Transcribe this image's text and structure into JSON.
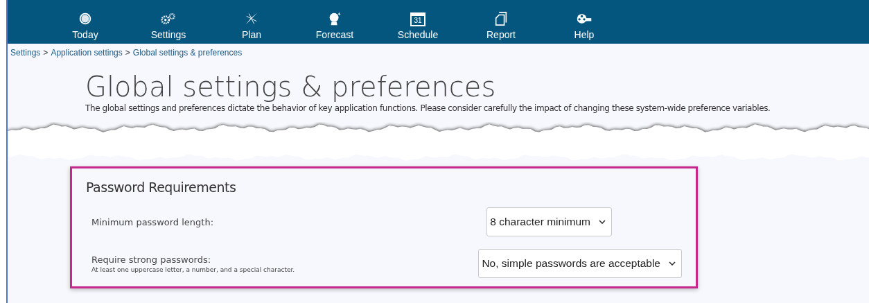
{
  "nav": [
    {
      "label": "Today"
    },
    {
      "label": "Settings"
    },
    {
      "label": "Plan"
    },
    {
      "label": "Forecast"
    },
    {
      "label": "Schedule"
    },
    {
      "label": "Report"
    },
    {
      "label": "Help"
    }
  ],
  "calendar_day": "31",
  "breadcrumb": [
    "Settings",
    ">",
    "Application settings",
    ">",
    "Global settings & preferences"
  ],
  "title": "Global settings & preferences",
  "description": "The global settings and preferences dictate the behavior of key application functions. Please consider carefully the impact of changing these system-wide preference variables.",
  "section": {
    "title": "Password Requirements",
    "fields": [
      {
        "label": "Minimum password length:",
        "value": "8 character minimum"
      },
      {
        "label": "Require strong passwords:",
        "hint": "At least one uppercase letter, a number, and a special character.",
        "value": "No, simple passwords are acceptable"
      }
    ]
  }
}
